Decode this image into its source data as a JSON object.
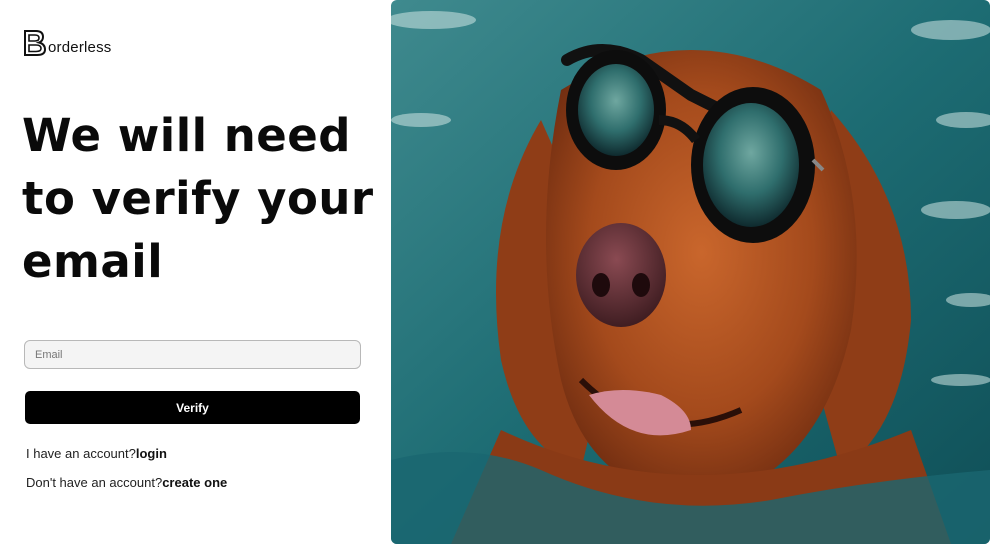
{
  "brand": {
    "logo_letter": "B",
    "name": "orderless"
  },
  "heading": "We will need to verify your email",
  "form": {
    "email_placeholder": "Email",
    "email_value": "",
    "verify_label": "Verify"
  },
  "links": {
    "login_prompt": "I have an account?",
    "login_label": "login",
    "signup_prompt": "Don't have an account?",
    "signup_label": "create one"
  },
  "photo": {
    "icon": "dog-with-sunglasses-image"
  },
  "colors": {
    "button_bg": "#000000",
    "button_text": "#ffffff",
    "water": "#1f6f76",
    "fur": "#b5531f"
  }
}
